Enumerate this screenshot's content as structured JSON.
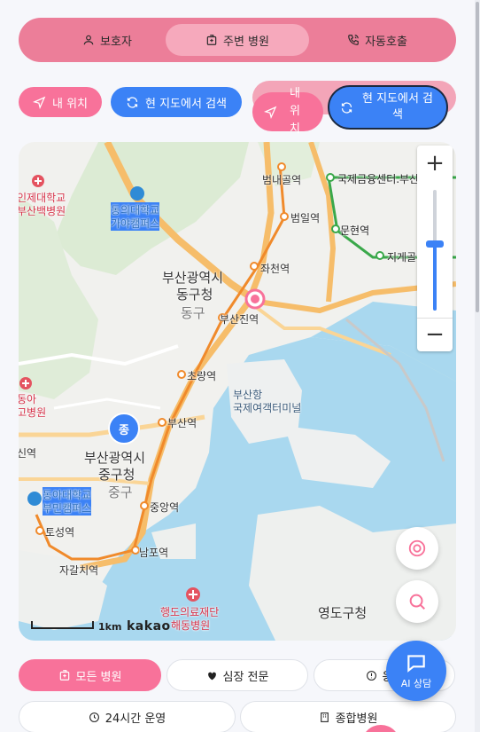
{
  "nav": {
    "tabs": [
      {
        "label": "보호자",
        "icon": "person-icon"
      },
      {
        "label": "주변 병원",
        "icon": "hospital-icon"
      },
      {
        "label": "자동호출",
        "icon": "phone-icon"
      }
    ],
    "active_tab": 1
  },
  "actions": {
    "my_location": "내 위치",
    "search_here": "현 지도에서 검색",
    "my_location_dup": "내 위치",
    "search_here_dup": "현 지도에서 검색"
  },
  "map": {
    "labels": {
      "hospital_1a": "인제대학교",
      "hospital_1b": "부산백병원",
      "uni_1a": "동의대학교",
      "uni_1b": "가야캠퍼스",
      "station_beomnae": "범내골역",
      "station_ifc": "국제금융센터.부산",
      "station_beomil": "범일역",
      "station_munhyeon": "문현역",
      "station_jige": "지게골역",
      "station_jwacheon": "좌천역",
      "district_dong_1": "부산광역시",
      "district_dong_2": "동구청",
      "district_dong_3": "동구",
      "station_busanjin": "부산진역",
      "station_choryang": "초량역",
      "hospital_2a": "동아",
      "hospital_2b": "고병원",
      "port_1": "부산항",
      "port_2": "국제여객터미널",
      "station_busan": "부산역",
      "station_sin": "신역",
      "district_jung_1": "부산광역시",
      "district_jung_2": "중구청",
      "district_jung_3": "중구",
      "uni_2a": "동아대학교",
      "uni_2b": "부민캠퍼스",
      "station_jungang": "중앙역",
      "station_toseong": "토성역",
      "station_nampo": "남포역",
      "station_jagalchi": "자갈치역",
      "hospital_3a": "행도의료재단",
      "hospital_3b": "해동병원",
      "district_yeongdo": "영도구청",
      "cluster_badge": "종",
      "scale": "1km",
      "brand": "kakao"
    },
    "zoom_level_fraction": 0.55
  },
  "filters": [
    {
      "label": "모든 병원",
      "icon": "hospital-icon",
      "active": true
    },
    {
      "label": "심장 전문",
      "icon": "heart-icon",
      "active": false
    },
    {
      "label": "응급",
      "icon": "alert-icon",
      "active": false
    },
    {
      "label": "24시간 운영",
      "icon": "clock-icon",
      "active": false
    },
    {
      "label": "종합병원",
      "icon": "building-icon",
      "active": false
    }
  ],
  "ai_chat": {
    "label": "AI 상담"
  },
  "colors": {
    "pink": "#f8729a",
    "nav_bg": "#ec7e99",
    "blue": "#3b82f6",
    "water": "#a9d8ef"
  }
}
